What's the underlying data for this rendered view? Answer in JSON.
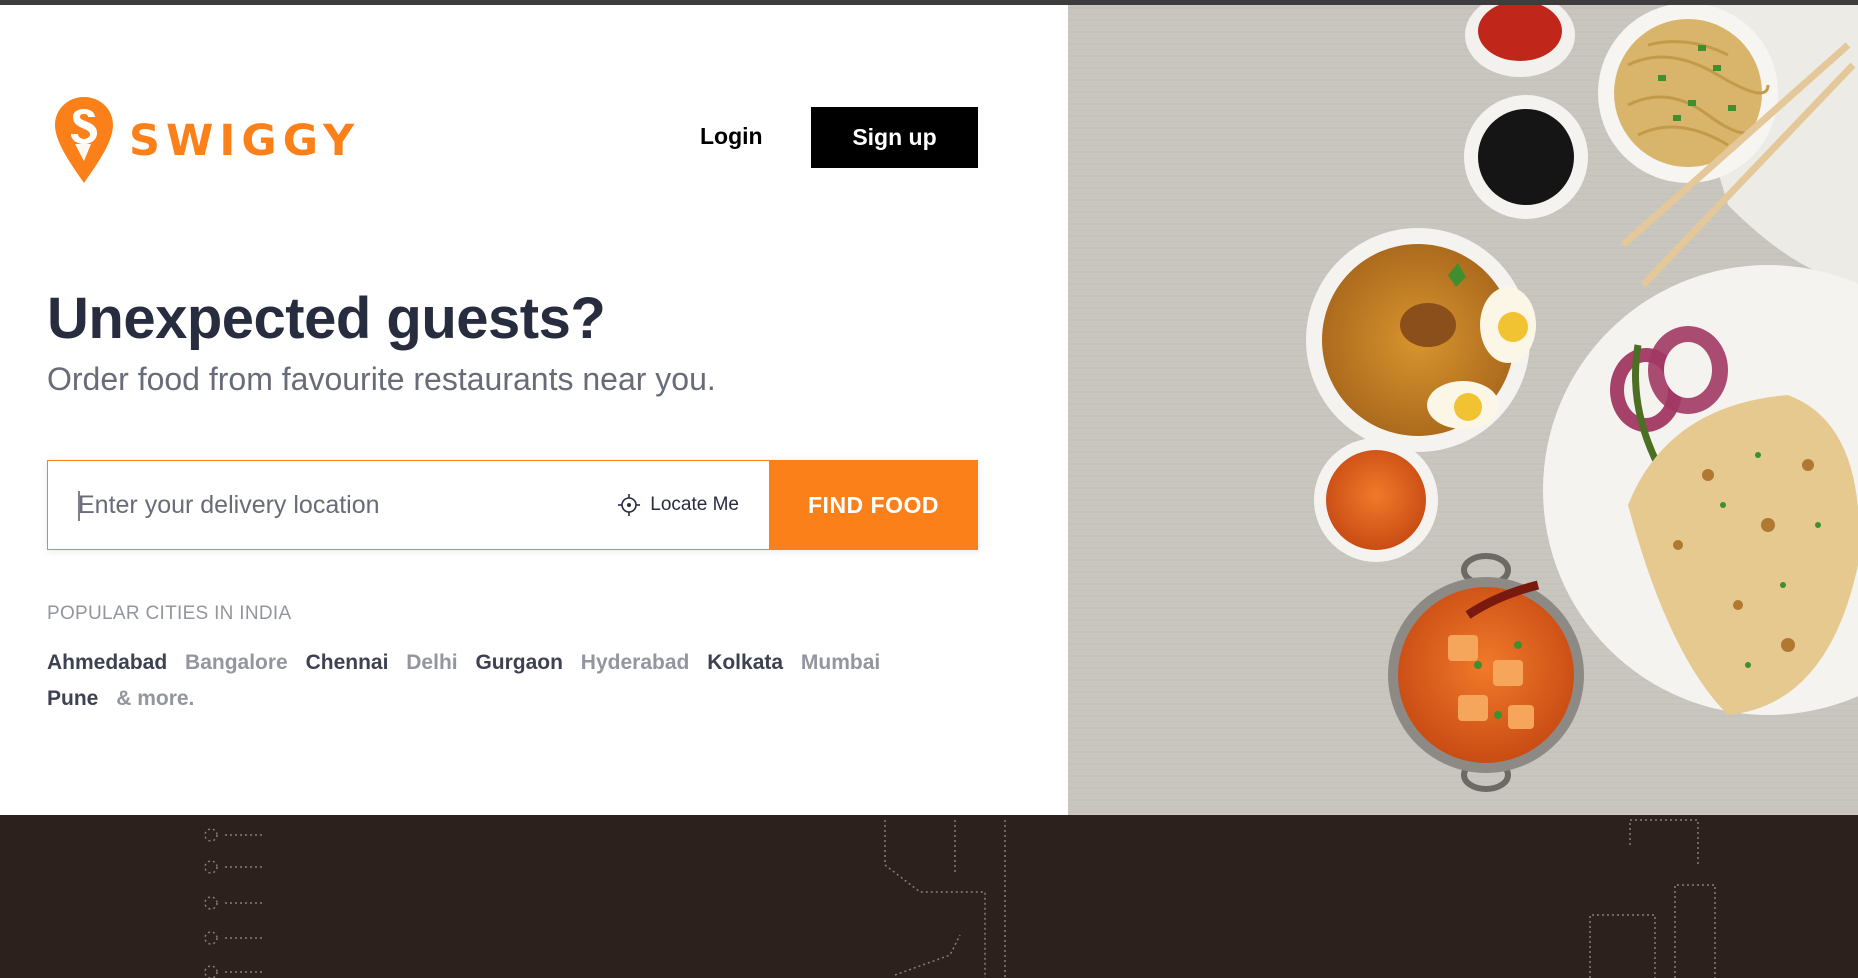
{
  "brand": {
    "name": "SWIGGY",
    "color": "#fc8019"
  },
  "header": {
    "login_label": "Login",
    "signup_label": "Sign up"
  },
  "hero": {
    "title": "Unexpected guests?",
    "subtitle": "Order food from favourite restaurants near you."
  },
  "search": {
    "placeholder": "Enter your delivery location",
    "value": "",
    "locate_label": "Locate Me",
    "locate_icon": "crosshair-icon",
    "submit_label": "FIND FOOD"
  },
  "cities": {
    "title": "POPULAR CITIES IN INDIA",
    "items": [
      "Ahmedabad",
      "Bangalore",
      "Chennai",
      "Delhi",
      "Gurgaon",
      "Hyderabad",
      "Kolkata",
      "Mumbai",
      "Pune"
    ],
    "more_label": "& more."
  },
  "colors": {
    "accent": "#fc8019",
    "text_dark": "#282c3f",
    "text_muted": "#686b78",
    "footer_bg": "#2d211d"
  }
}
